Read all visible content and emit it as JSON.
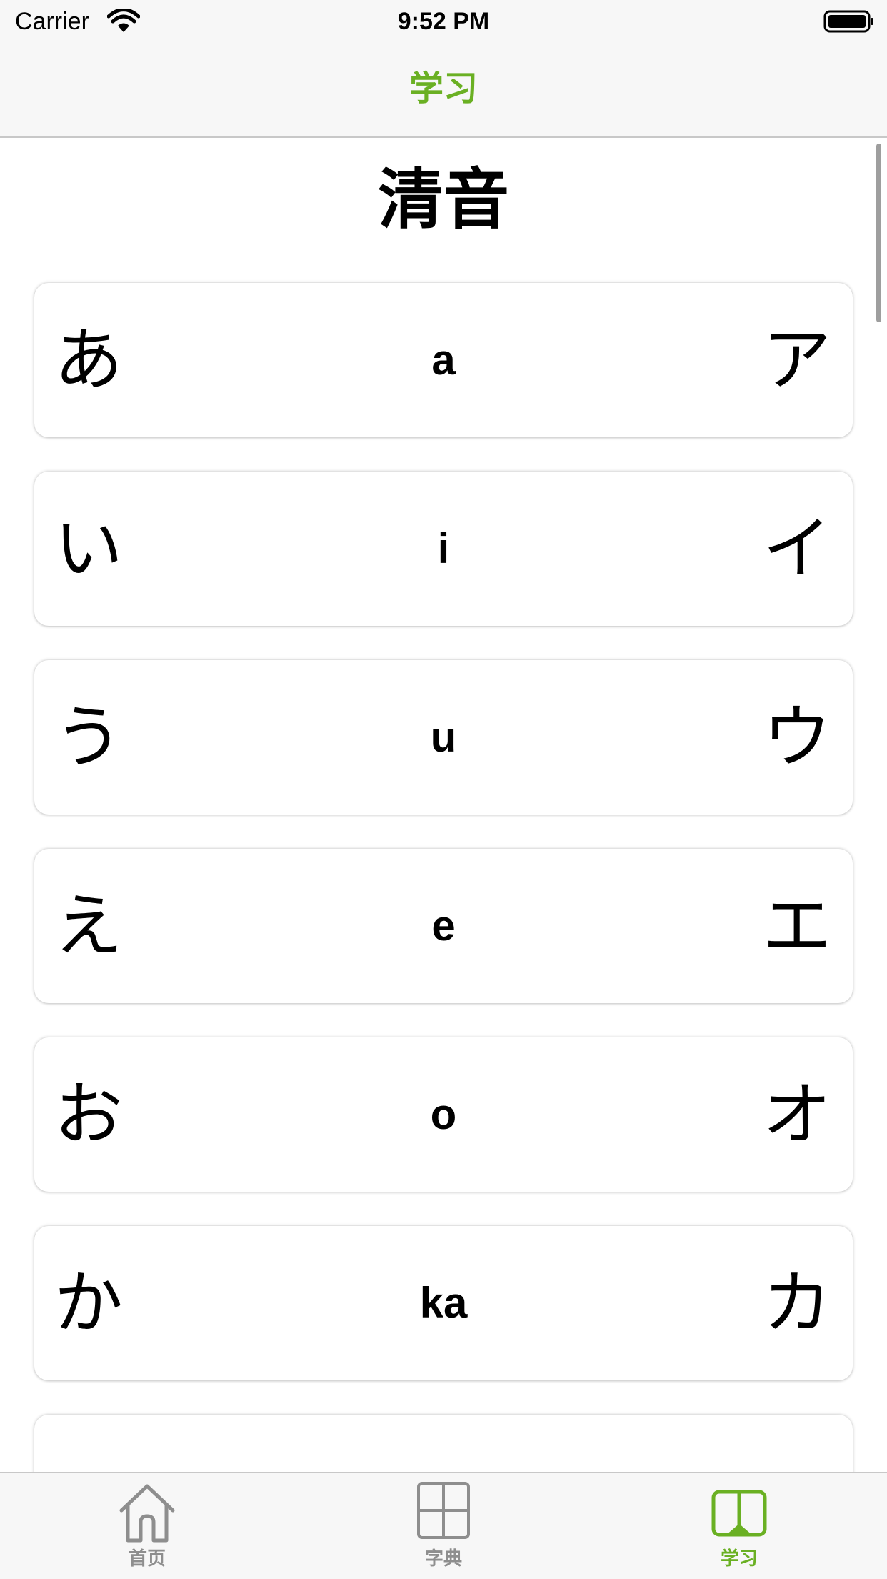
{
  "status_bar": {
    "carrier": "Carrier",
    "time": "9:52 PM"
  },
  "nav": {
    "title": "学习"
  },
  "section": {
    "title": "清音"
  },
  "kana": [
    {
      "hiragana": "あ",
      "romaji": "a",
      "katakana": "ア"
    },
    {
      "hiragana": "い",
      "romaji": "i",
      "katakana": "イ"
    },
    {
      "hiragana": "う",
      "romaji": "u",
      "katakana": "ウ"
    },
    {
      "hiragana": "え",
      "romaji": "e",
      "katakana": "エ"
    },
    {
      "hiragana": "お",
      "romaji": "o",
      "katakana": "オ"
    },
    {
      "hiragana": "か",
      "romaji": "ka",
      "katakana": "カ"
    }
  ],
  "tabs": [
    {
      "label": "首页",
      "icon": "home-icon",
      "active": false
    },
    {
      "label": "字典",
      "icon": "grid-icon",
      "active": false
    },
    {
      "label": "学习",
      "icon": "book-icon",
      "active": true
    }
  ],
  "colors": {
    "accent": "#6ab023",
    "inactive": "#8e8e8e"
  }
}
